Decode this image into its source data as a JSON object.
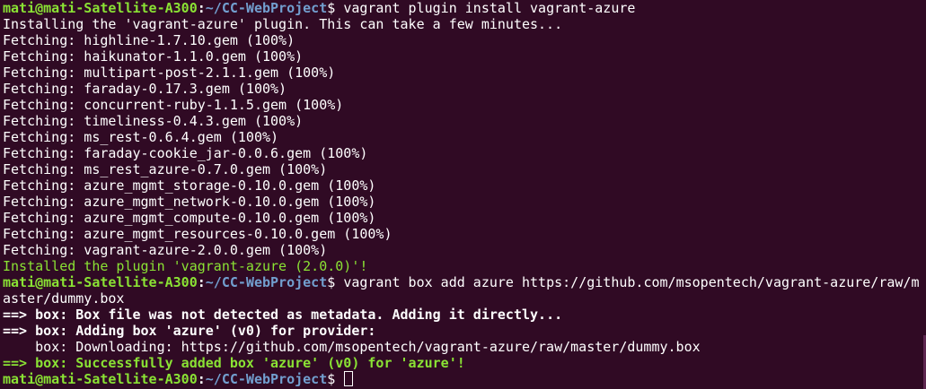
{
  "terminal": {
    "prompt": {
      "user_host": "mati@mati-Satellite-A300",
      "colon": ":",
      "path": "~/CC-WebProject",
      "dollar": "$ "
    },
    "cmd1": "vagrant plugin install vagrant-azure",
    "installing": "Installing the 'vagrant-azure' plugin. This can take a few minutes...",
    "fetch_lines": [
      "Fetching: highline-1.7.10.gem (100%)",
      "Fetching: haikunator-1.1.0.gem (100%)",
      "Fetching: multipart-post-2.1.1.gem (100%)",
      "Fetching: faraday-0.17.3.gem (100%)",
      "Fetching: concurrent-ruby-1.1.5.gem (100%)",
      "Fetching: timeliness-0.4.3.gem (100%)",
      "Fetching: ms_rest-0.6.4.gem (100%)",
      "Fetching: faraday-cookie_jar-0.0.6.gem (100%)",
      "Fetching: ms_rest_azure-0.7.0.gem (100%)",
      "Fetching: azure_mgmt_storage-0.10.0.gem (100%)",
      "Fetching: azure_mgmt_network-0.10.0.gem (100%)",
      "Fetching: azure_mgmt_compute-0.10.0.gem (100%)",
      "Fetching: azure_mgmt_resources-0.10.0.gem (100%)",
      "Fetching: vagrant-azure-2.0.0.gem (100%)"
    ],
    "installed": "Installed the plugin 'vagrant-azure (2.0.0)'!",
    "cmd2": "vagrant box add azure https://github.com/msopentech/vagrant-azure/raw/m",
    "cmd2_wrap": "aster/dummy.box",
    "box_lines": {
      "arrow": "==> ",
      "line1": "box: Box file was not detected as metadata. Adding it directly...",
      "line2": "box: Adding box 'azure' (v0) for provider:",
      "line3": "    box: Downloading: https://github.com/msopentech/vagrant-azure/raw/master/dummy.box",
      "line4": "box: Successfully added box 'azure' (v0) for 'azure'!"
    },
    "colors": {
      "background": "#300a24",
      "prompt_user": "#8ae234",
      "prompt_path": "#729fcf",
      "text": "#ffffff",
      "success": "#8ae234"
    }
  }
}
